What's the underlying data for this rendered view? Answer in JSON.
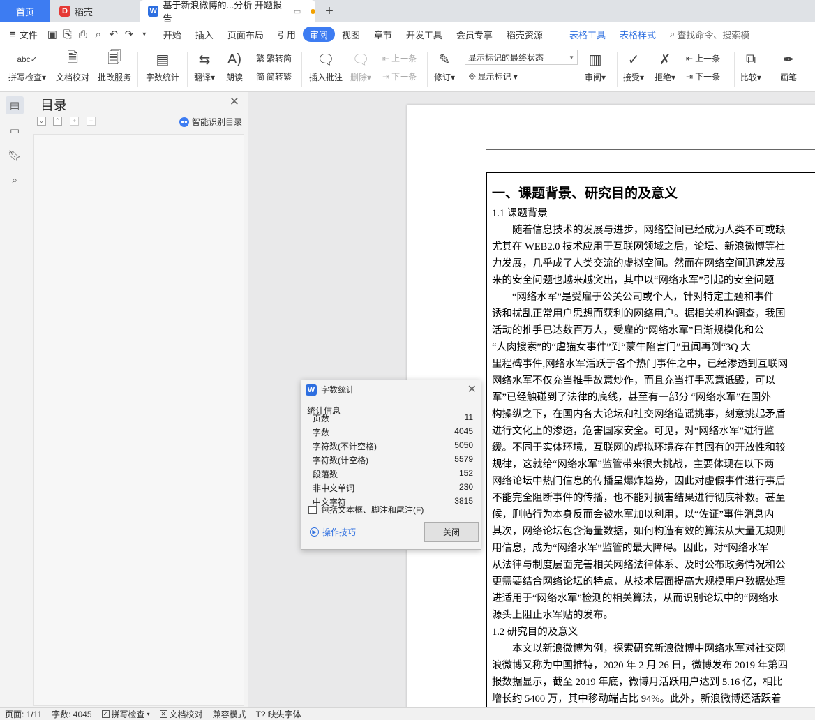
{
  "tabs": {
    "home": "首页",
    "doke": "稻壳",
    "doc": "基于新浪微博的...分析 开题报告",
    "doke_logo": "D",
    "doc_logo": "W",
    "add": "+"
  },
  "menu": {
    "file": "文件",
    "items": [
      "开始",
      "插入",
      "页面布局",
      "引用",
      "审阅",
      "视图",
      "章节",
      "开发工具",
      "会员专享",
      "稻壳资源"
    ],
    "active": "审阅",
    "context_items": [
      "表格工具",
      "表格样式"
    ],
    "search": "查找命令、搜索模"
  },
  "ribbon": {
    "spell_check": "拼写检查",
    "doc_proof": "文档校对",
    "review_service": "批改服务",
    "word_count": "字数统计",
    "translate": "翻译",
    "read_aloud": "朗读",
    "trad_simp": "繁转简",
    "simp_trad": "简转繁",
    "insert_comment": "插入批注",
    "delete": "删除",
    "prev": "上一条",
    "next": "下一条",
    "revise": "修订",
    "show_final": "显示标记的最终状态",
    "show_marks": "显示标记",
    "review": "审阅",
    "accept": "接受",
    "reject": "拒绝",
    "prev2": "上一条",
    "next2": "下一条",
    "compare": "比较",
    "pen": "画笔"
  },
  "toc": {
    "title": "目录",
    "smart": "智能识别目录"
  },
  "document": {
    "heading": "一、课题背景、研究目的及意义",
    "sub1": "1.1 课题背景",
    "lines1": [
      "　　随着信息技术的发展与进步，网络空间已经成为人类不可或缺",
      "尤其在 WEB2.0 技术应用于互联网领域之后，论坛、新浪微博等社",
      "力发展，几乎成了人类交流的虚拟空间。然而在网络空间迅速发展",
      "来的安全问题也越来越突出，其中以“网络水军”引起的安全问题",
      "　　“网络水军”是受雇于公关公司或个人，针对特定主题和事件",
      "诱和扰乱正常用户思想而获利的网络用户。据相关机构调查，我国",
      "活动的推手已达数百万人，受雇的“网络水军”日渐规模化和公",
      "“人肉搜索”的“虐猫女事件”到“蒙牛陷害门”丑闻再到“3Q 大",
      "里程碑事件,网络水军活跃于各个热门事件之中，已经渗透到互联网",
      "网络水军不仅充当推手故意炒作，而且充当打手恶意诋毁，可以",
      "军”已经触碰到了法律的底线，甚至有一部分 “网络水军”在国外",
      "构操纵之下，在国内各大论坛和社交网络造谣挑事，刻意挑起矛盾",
      "进行文化上的渗透，危害国家安全。可见，对“网络水军”进行监",
      "缓。不同于实体环境，互联网的虚拟环境存在其固有的开放性和较",
      "规律，这就给“网络水军”监管带来很大挑战，主要体现在以下两",
      "网络论坛中热门信息的传播呈爆炸趋势，因此对虚假事件进行事后",
      "不能完全阻断事件的传播，也不能对损害结果进行彻底补救。甚至",
      "候，删帖行为本身反而会被水军加以利用，以“佐证”事件消息内",
      "其次，网络论坛包含海量数据，如何构造有效的算法从大量无规则",
      "用信息，成为“网络水军”监管的最大障碍。因此，对“网络水军",
      "从法律与制度层面完善相关网络法律体系、及时公布政务情况和公",
      "更需要结合网络论坛的特点，从技术层面提高大规模用户数据处理",
      "进适用于“网络水军”检测的相关算法，从而识别论坛中的“网络水",
      "源头上阻止水军贴的发布。"
    ],
    "sub2": "1.2 研究目的及意义",
    "lines2": [
      "　　本文以新浪微博为例，探索研究新浪微博中网络水军对社交网",
      "浪微博又称为中国推特，2020 年 2 月 26 日，微博发布 2019 年第四",
      "报数据显示，截至 2019 年底，微博月活跃用户达到 5.16 亿，相比",
      "增长约 5400 万，其中移动端占比 94%。此外，新浪微博还活跃着"
    ]
  },
  "dialog": {
    "title": "字数统计",
    "section": "统计信息",
    "stats": [
      {
        "label": "页数",
        "value": "11"
      },
      {
        "label": "字数",
        "value": "4045"
      },
      {
        "label": "字符数(不计空格)",
        "value": "5050"
      },
      {
        "label": "字符数(计空格)",
        "value": "5579"
      },
      {
        "label": "段落数",
        "value": "152"
      },
      {
        "label": "非中文单词",
        "value": "230"
      },
      {
        "label": "中文字符",
        "value": "3815"
      }
    ],
    "include": "包括文本框、脚注和尾注(F)",
    "tips": "操作技巧",
    "close": "关闭"
  },
  "status": {
    "page": "页面: 1/11",
    "words": "字数: 4045",
    "spell": "拼写检查",
    "proof": "文档校对",
    "compat": "兼容模式",
    "font": "缺失字体"
  },
  "colors": {
    "accent": "#3d7cf2",
    "context_tab": "#2e6fe0"
  }
}
